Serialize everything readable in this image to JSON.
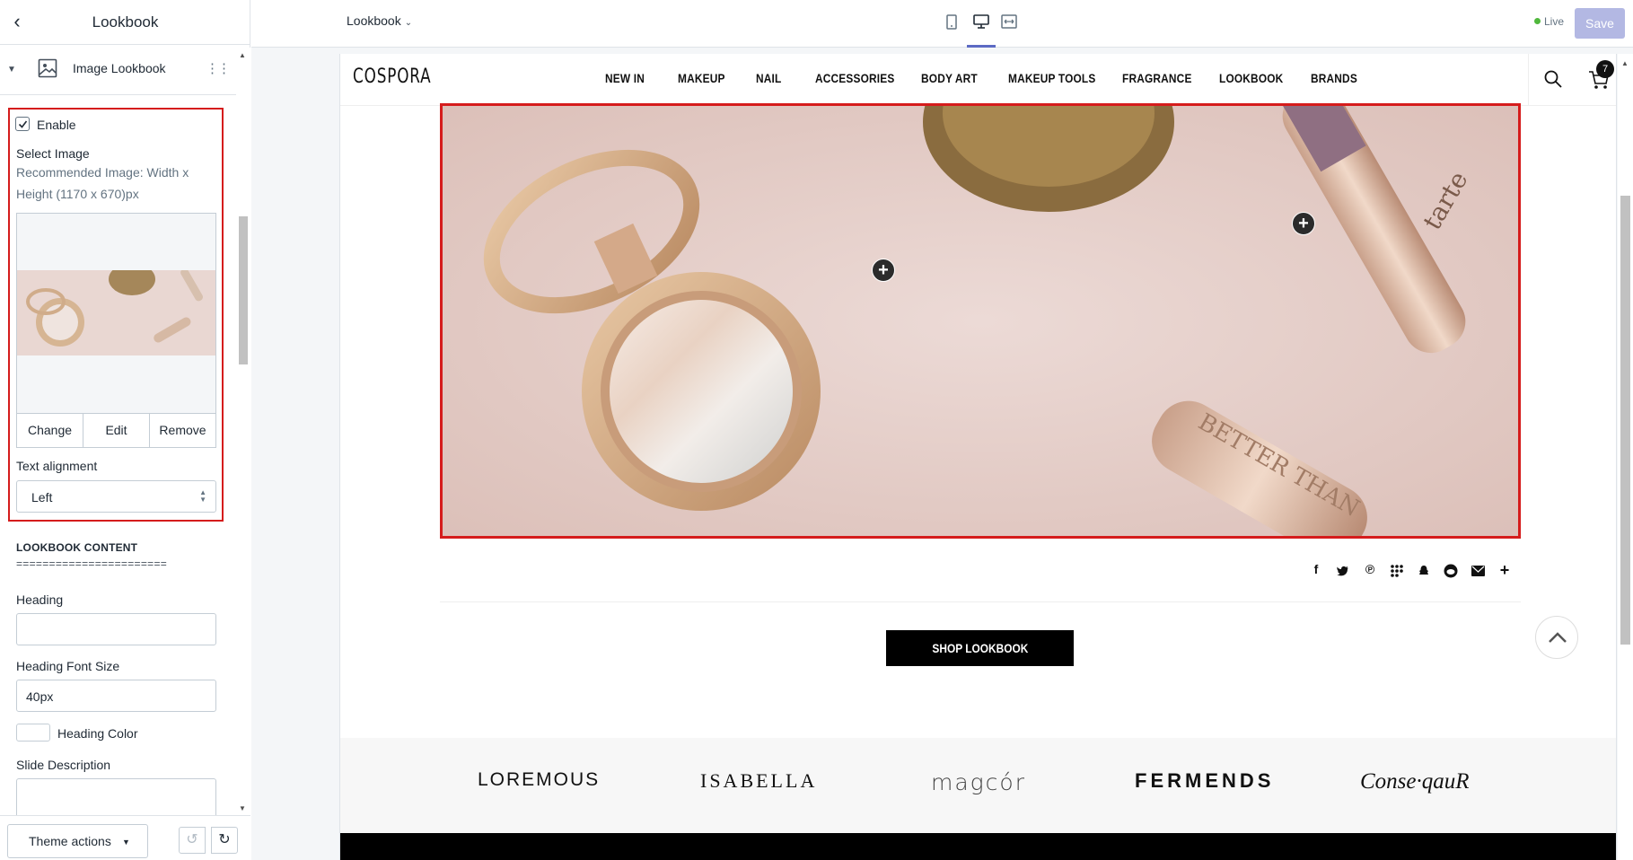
{
  "sidebar": {
    "title": "Lookbook",
    "block": {
      "label": "Image Lookbook"
    },
    "enable_label": "Enable",
    "select_image_label": "Select Image",
    "recommended_text": "Recommended Image: Width x Height (1170 x 670)px",
    "image_buttons": {
      "change": "Change",
      "edit": "Edit",
      "remove": "Remove"
    },
    "text_alignment_label": "Text alignment",
    "text_alignment_value": "Left",
    "section_title": "LOOKBOOK CONTENT",
    "section_separator": "=======================",
    "heading_label": "Heading",
    "heading_value": "",
    "heading_font_size_label": "Heading Font Size",
    "heading_font_size_value": "40px",
    "heading_color_label": "Heading Color",
    "slide_description_label": "Slide Description",
    "theme_actions_label": "Theme actions"
  },
  "topbar": {
    "page_select": "Lookbook",
    "live_label": "Live",
    "save_label": "Save",
    "accent": "#5c6ac4"
  },
  "site": {
    "brand": "COSPORA",
    "nav": [
      "NEW IN",
      "MAKEUP",
      "NAIL",
      "ACCESSORIES",
      "BODY ART",
      "MAKEUP TOOLS",
      "FRAGRANCE",
      "LOOKBOOK",
      "BRANDS"
    ],
    "cart_count": "7",
    "shop_button": "SHOP LOOKBOOK",
    "share_icons": [
      "facebook-icon",
      "twitter-icon",
      "pinterest-icon",
      "grid-icon",
      "snapchat-icon",
      "reddit-icon",
      "email-icon",
      "plus-icon"
    ],
    "brand_logos": [
      "LOREMOUS",
      "ISABELLA",
      "magcór",
      "FERMENDS",
      "Conse·qauR"
    ],
    "hero_product_text": [
      "tarte",
      "BETTER THAN"
    ]
  }
}
